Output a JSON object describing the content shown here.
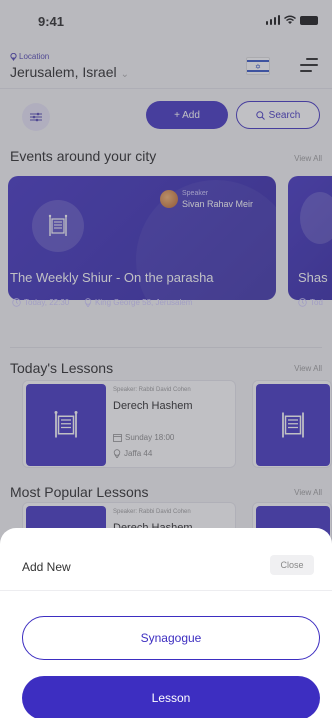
{
  "status_bar": {
    "time": "9:41"
  },
  "header": {
    "location_label": "Location",
    "city": "Jerusalem, Israel"
  },
  "toolbar": {
    "add_label": "+ Add",
    "search_label": "Search"
  },
  "events": {
    "title": "Events around your city",
    "view_all": "View All",
    "items": [
      {
        "speaker_label": "Speaker",
        "speaker_name": "Sivan Rahav Meir",
        "title": "The Weekly Shiur - On the parasha",
        "time": "Today, 22:30",
        "place": "King George 58, Jerusalem"
      },
      {
        "title": "Shas",
        "time": "Tod"
      }
    ]
  },
  "todays_lessons": {
    "title": "Today's Lessons",
    "view_all": "View All",
    "items": [
      {
        "speaker": "Speaker: Rabbi David Cohen",
        "title": "Derech Hashem",
        "day": "Sunday 18:00",
        "place": "Jaffa 44"
      }
    ]
  },
  "popular_lessons": {
    "title": "Most Popular Lessons",
    "view_all": "View All",
    "items": [
      {
        "speaker": "Speaker: Rabbi David Cohen",
        "title": "Derech Hashem"
      }
    ]
  },
  "sheet": {
    "title": "Add New",
    "close_label": "Close",
    "synagogue_label": "Synagogue",
    "lesson_label": "Lesson"
  },
  "colors": {
    "accent": "#3d2ec1",
    "background": "#f4f4f6"
  }
}
